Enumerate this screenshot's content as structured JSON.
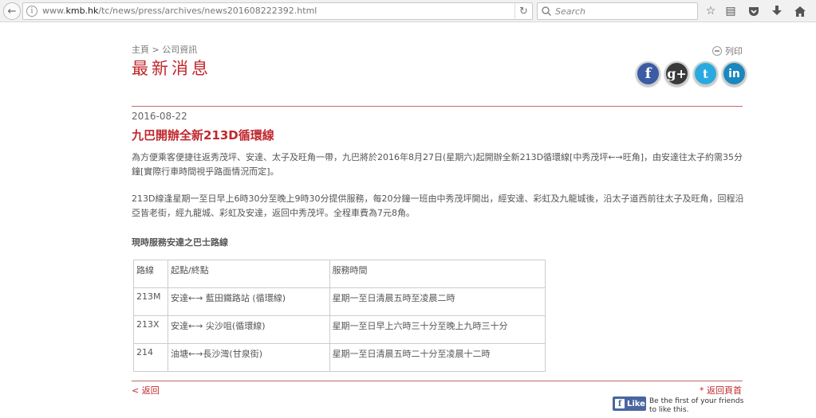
{
  "browser": {
    "url_prefix": "www.",
    "url_host": "kmb.hk",
    "url_path": "/tc/news/press/archives/news201608222392.html",
    "search_placeholder": "Search"
  },
  "page": {
    "breadcrumb": "主頁 > 公司資訊",
    "title": "最新消息",
    "print_label": "列印",
    "social": {
      "facebook": "f",
      "googleplus": "g+",
      "twitter": "t",
      "linkedin": "in"
    }
  },
  "article": {
    "date": "2016-08-22",
    "headline": "九巴開辦全新213D循環線",
    "paragraph1": "為方便乘客便捷往返秀茂坪、安達、太子及旺角一帶，九巴將於2016年8月27日(星期六)起開辦全新213D循環線[中秀茂坪←→旺角]，由安達往太子約需35分鐘[實際行車時間視乎路面情況而定]。",
    "paragraph2": "213D線逢星期一至日早上6時30分至晚上9時30分提供服務，每20分鐘一班由中秀茂坪開出，經安達、彩虹及九龍城後，沿太子道西前往太子及旺角，回程沿亞皆老街，經九龍城、彩虹及安達，返回中秀茂坪。全程車費為7元8角。",
    "section_title": "現時服務安達之巴士路線",
    "table": {
      "headers": [
        "路線",
        "起點/終點",
        "服務時間"
      ],
      "rows": [
        [
          "213M",
          "安達←→ 藍田鐵路站 (循環線)",
          "星期一至日清晨五時至凌晨二時"
        ],
        [
          "213X",
          "安達←→ 尖沙咀(循環線)",
          "星期一至日早上六時三十分至晚上九時三十分"
        ],
        [
          "214",
          "油塘←→長沙灣(甘泉街)",
          "星期一至日清晨五時二十分至凌晨十二時"
        ]
      ]
    }
  },
  "footer": {
    "back_link": "< 返回",
    "top_link": "* 返回頁首",
    "fb_like_label": "Like",
    "fb_like_text": "Be the first of your friends to like this."
  }
}
